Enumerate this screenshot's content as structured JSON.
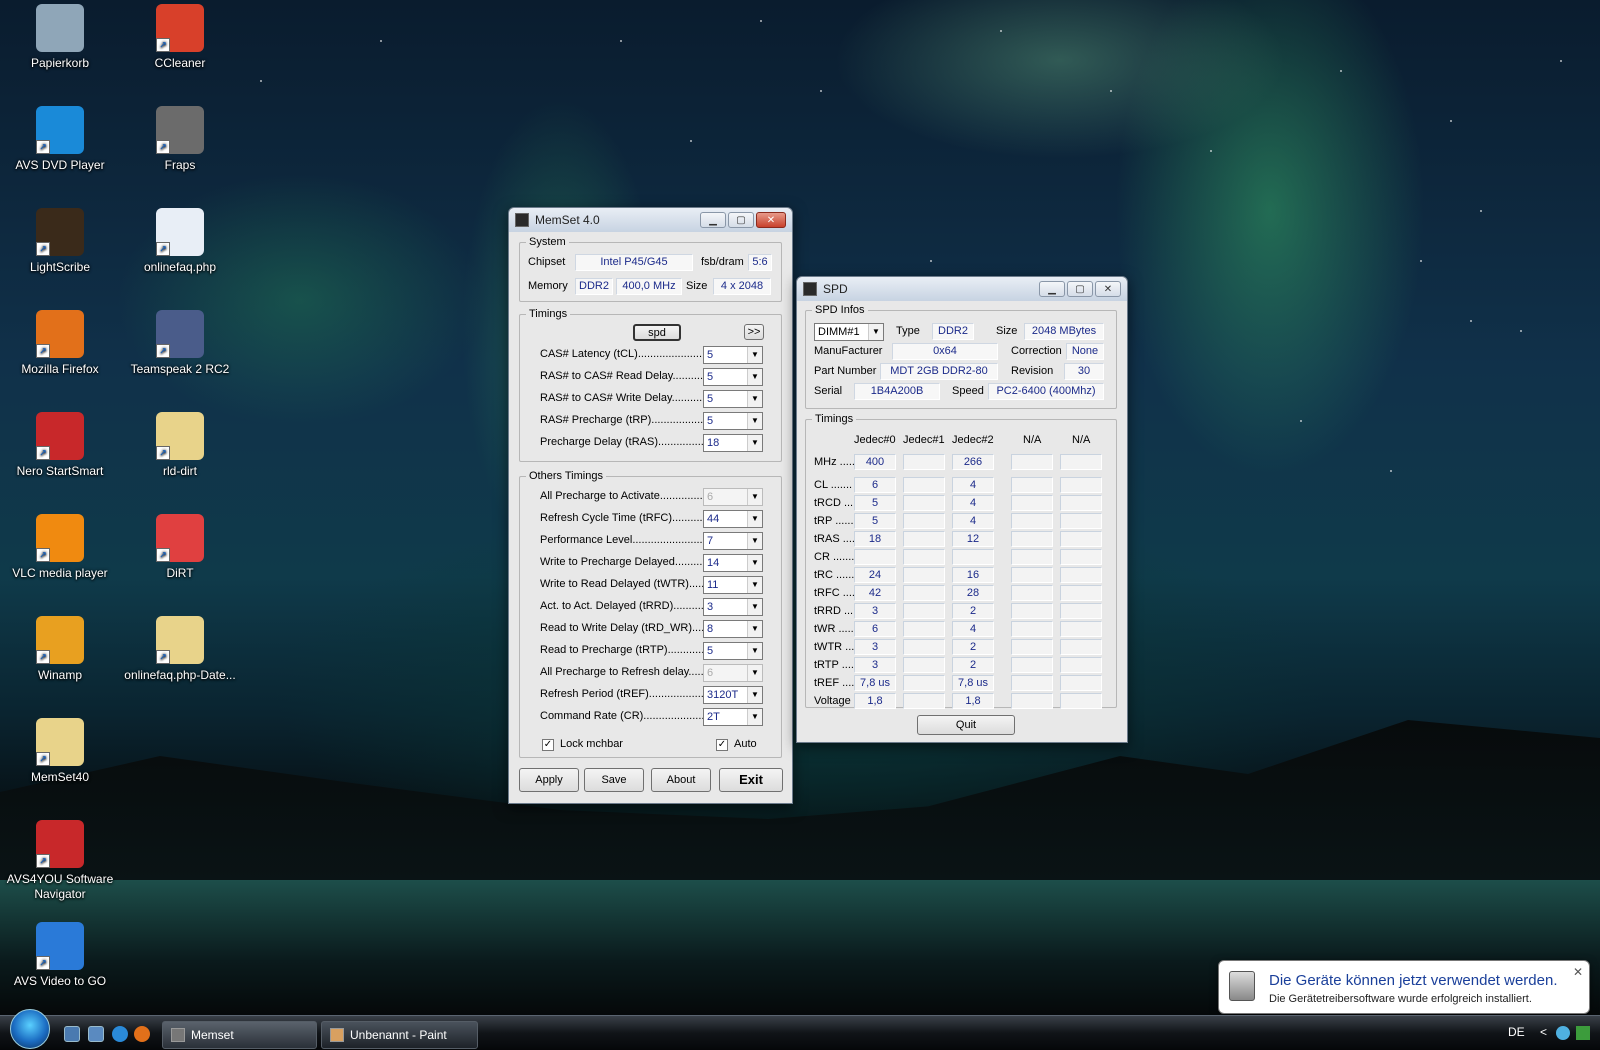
{
  "desktop_icons": [
    {
      "label": "Papierkorb",
      "icon": "recycle-bin-icon",
      "color": "#8fa6b8"
    },
    {
      "label": "CCleaner",
      "icon": "ccleaner-icon",
      "color": "#d8402a"
    },
    {
      "label": "AVS DVD Player",
      "icon": "dvd-play-icon",
      "color": "#1a8ad8"
    },
    {
      "label": "Fraps",
      "icon": "fraps-icon",
      "color": "#6b6b6b"
    },
    {
      "label": "LightScribe",
      "icon": "lightscribe-icon",
      "color": "#3a2a1a"
    },
    {
      "label": "onlinefaq.php",
      "icon": "firefox-document-icon",
      "color": "#e8eef6"
    },
    {
      "label": "Mozilla Firefox",
      "icon": "firefox-icon",
      "color": "#e2701a"
    },
    {
      "label": "Teamspeak 2 RC2",
      "icon": "teamspeak-icon",
      "color": "#4a5c8a"
    },
    {
      "label": "Nero StartSmart",
      "icon": "nero-icon",
      "color": "#c8282a"
    },
    {
      "label": "rld-dirt",
      "icon": "folder-icon",
      "color": "#e8d38a"
    },
    {
      "label": "VLC media player",
      "icon": "vlc-cone-icon",
      "color": "#f08a10"
    },
    {
      "label": "DiRT",
      "icon": "dirt-icon",
      "color": "#e04040"
    },
    {
      "label": "Winamp",
      "icon": "winamp-icon",
      "color": "#e8a020"
    },
    {
      "label": "onlinefaq.php-Date...",
      "icon": "folder-icon",
      "color": "#e8d38a"
    },
    {
      "label": "MemSet40",
      "icon": "folder-icon",
      "color": "#e8d38a"
    },
    {
      "label": "AVS4YOU Software Navigator",
      "icon": "avs4you-icon",
      "color": "#c8282a"
    },
    {
      "label": "AVS Video to GO",
      "icon": "avs-video-icon",
      "color": "#2a7ad8"
    }
  ],
  "memset": {
    "title": "MemSet 4.0",
    "system": {
      "legend": "System",
      "chipset_label": "Chipset",
      "chipset": "Intel P45/G45",
      "fsb_label": "fsb/dram",
      "fsb": "5:6",
      "memory_label": "Memory",
      "memory_type": "DDR2",
      "memory_speed": "400,0 MHz",
      "size_label": "Size",
      "size": "4 x 2048"
    },
    "timings": {
      "legend": "Timings",
      "spd_button": "spd",
      "more_button": ">>",
      "rows": [
        {
          "label": "CAS# Latency (tCL)........................",
          "value": "5"
        },
        {
          "label": "RAS# to CAS# Read Delay............",
          "value": "5"
        },
        {
          "label": "RAS# to CAS# Write Delay.............",
          "value": "5"
        },
        {
          "label": "RAS# Precharge (tRP).....................",
          "value": "5"
        },
        {
          "label": "Precharge Delay  (tRAS)...................",
          "value": "18"
        }
      ]
    },
    "others": {
      "legend": "Others Timings",
      "rows": [
        {
          "label": "All Precharge to Activate...................",
          "value": "6",
          "disabled": true
        },
        {
          "label": "Refresh Cycle Time (tRFC)...............",
          "value": "44"
        },
        {
          "label": "Performance Level..............................",
          "value": "7"
        },
        {
          "label": "Write to Precharge Delayed.............",
          "value": "14"
        },
        {
          "label": "Write to Read Delayed (tWTR)........",
          "value": "11"
        },
        {
          "label": "Act. to Act. Delayed (tRRD).............",
          "value": "3"
        },
        {
          "label": "Read to Write Delay (tRD_WR)........",
          "value": "8"
        },
        {
          "label": "Read to Precharge (tRTP)................",
          "value": "5"
        },
        {
          "label": "All Precharge to Refresh delay.........",
          "value": "6",
          "disabled": true
        },
        {
          "label": "Refresh Period (tREF)......................",
          "value": "3120T"
        },
        {
          "label": "Command Rate (CR).........................",
          "value": "2T"
        }
      ],
      "lock_label": "Lock mchbar",
      "auto_label": "Auto"
    },
    "buttons": {
      "apply": "Apply",
      "save": "Save",
      "about": "About",
      "exit": "Exit"
    }
  },
  "spd": {
    "title": "SPD",
    "infos": {
      "legend": "SPD Infos",
      "dimm": "DIMM#1",
      "type_label": "Type",
      "type": "DDR2",
      "size_label": "Size",
      "size": "2048 MBytes",
      "manufacturer_label": "ManuFacturer",
      "manufacturer": "0x64",
      "correction_label": "Correction",
      "correction": "None",
      "part_label": "Part Number",
      "part": "MDT 2GB    DDR2-80",
      "revision_label": "Revision",
      "revision": "30",
      "serial_label": "Serial",
      "serial": "1B4A200B",
      "speed_label": "Speed",
      "speed": "PC2-6400 (400Mhz)"
    },
    "timings": {
      "legend": "Timings",
      "columns": [
        "Jedec#0",
        "Jedec#1",
        "Jedec#2",
        "N/A",
        "N/A"
      ],
      "rows": [
        {
          "label": "MHz .....",
          "values": [
            "400",
            "",
            "266",
            "",
            ""
          ]
        },
        {
          "label": "CL .......",
          "values": [
            "6",
            "",
            "4",
            "",
            ""
          ]
        },
        {
          "label": "tRCD .....",
          "values": [
            "5",
            "",
            "4",
            "",
            ""
          ]
        },
        {
          "label": "tRP .......",
          "values": [
            "5",
            "",
            "4",
            "",
            ""
          ]
        },
        {
          "label": "tRAS .....",
          "values": [
            "18",
            "",
            "12",
            "",
            ""
          ]
        },
        {
          "label": "CR .......",
          "values": [
            "",
            "",
            "",
            "",
            ""
          ]
        },
        {
          "label": "tRC .......",
          "values": [
            "24",
            "",
            "16",
            "",
            ""
          ]
        },
        {
          "label": "tRFC .....",
          "values": [
            "42",
            "",
            "28",
            "",
            ""
          ]
        },
        {
          "label": "tRRD .....",
          "values": [
            "3",
            "",
            "2",
            "",
            ""
          ]
        },
        {
          "label": "tWR .......",
          "values": [
            "6",
            "",
            "4",
            "",
            ""
          ]
        },
        {
          "label": "tWTR .....",
          "values": [
            "3",
            "",
            "2",
            "",
            ""
          ]
        },
        {
          "label": "tRTP .....",
          "values": [
            "3",
            "",
            "2",
            "",
            ""
          ]
        },
        {
          "label": "tREF .....",
          "values": [
            "7,8 us",
            "",
            "7,8 us",
            "",
            ""
          ]
        },
        {
          "label": "Voltage",
          "values": [
            "1,8",
            "",
            "1,8",
            "",
            ""
          ]
        }
      ]
    },
    "quit": "Quit"
  },
  "notification": {
    "title": "Die Geräte können jetzt verwendet werden.",
    "body": "Die Gerätetreibersoftware wurde erfolgreich installiert.",
    "close": "✕"
  },
  "taskbar": {
    "tasks": [
      {
        "label": "Memset"
      },
      {
        "label": "Unbenannt - Paint"
      }
    ],
    "language": "DE",
    "chevron": "<"
  }
}
